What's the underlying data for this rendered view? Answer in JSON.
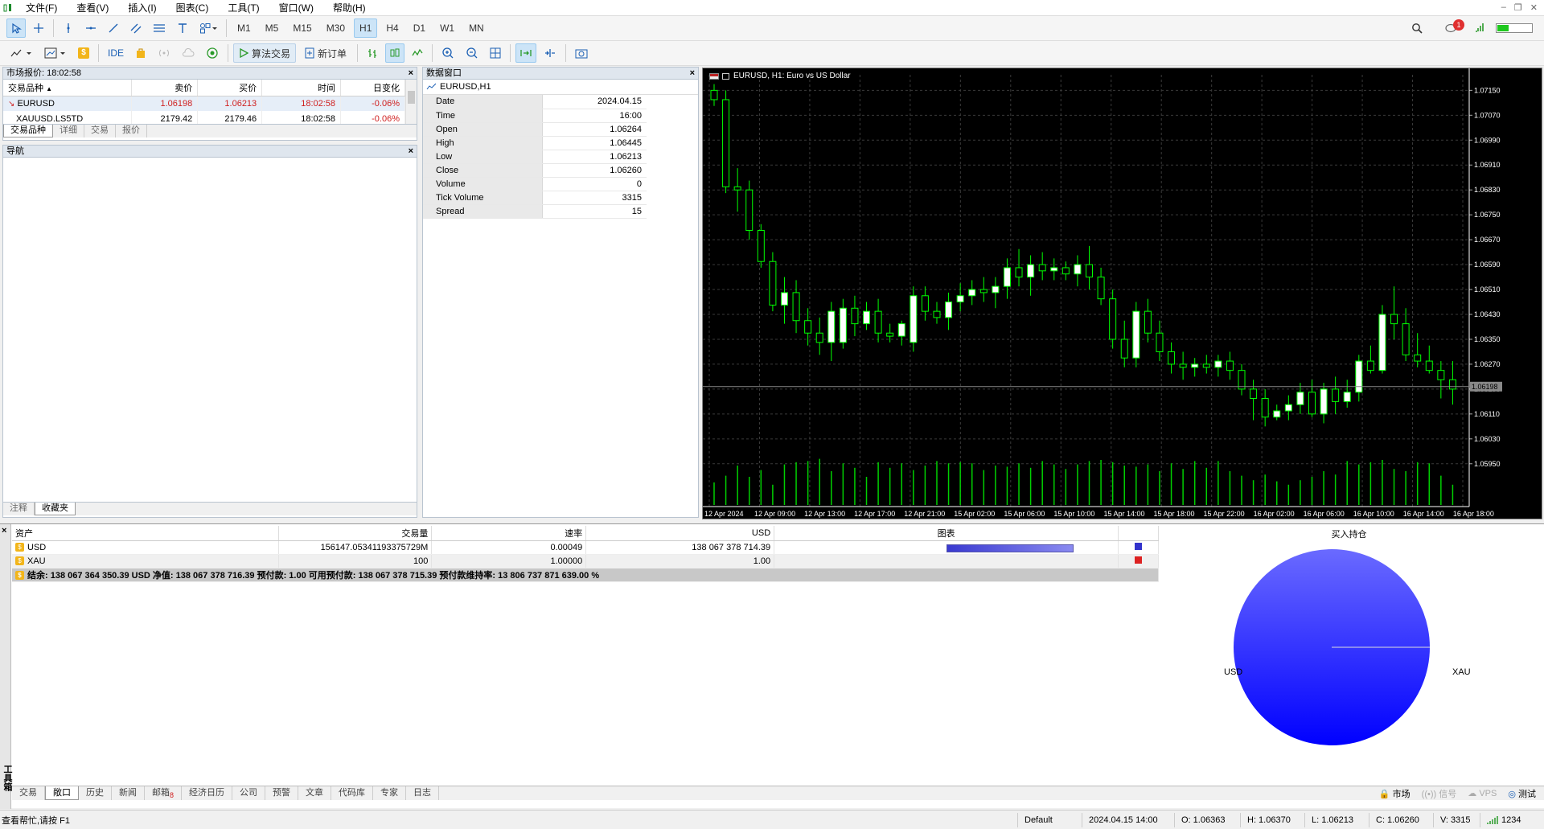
{
  "menu": [
    "文件(F)",
    "查看(V)",
    "插入(I)",
    "图表(C)",
    "工具(T)",
    "窗口(W)",
    "帮助(H)"
  ],
  "timeframes": [
    "M1",
    "M5",
    "M15",
    "M30",
    "H1",
    "H4",
    "D1",
    "W1",
    "MN"
  ],
  "active_timeframe": "H1",
  "toolbar2": {
    "ide": "IDE",
    "algo_trading": "算法交易",
    "new_order": "新订单"
  },
  "notifications_badge": "1",
  "market_watch": {
    "title": "市场报价: 18:02:58",
    "headers": [
      "交易品种",
      "卖价",
      "买价",
      "时间",
      "日变化"
    ],
    "rows": [
      {
        "symbol": "EURUSD",
        "bid": "1.06198",
        "ask": "1.06213",
        "time": "18:02:58",
        "change": "-0.06%"
      },
      {
        "symbol": "XAUUSD.LS5TD",
        "bid": "2179.42",
        "ask": "2179.46",
        "time": "18:02:58",
        "change": "-0.06%"
      }
    ],
    "tabs": [
      "交易品种",
      "详细",
      "交易",
      "报价"
    ],
    "active_tab": "交易品种"
  },
  "navigator": {
    "title": "导航",
    "tabs": [
      "注释",
      "收藏夹"
    ],
    "active_tab": "收藏夹"
  },
  "data_window": {
    "title": "数据窗口",
    "header": "EURUSD,H1",
    "rows": [
      {
        "k": "Date",
        "v": "2024.04.15"
      },
      {
        "k": "Time",
        "v": "16:00"
      },
      {
        "k": "Open",
        "v": "1.06264"
      },
      {
        "k": "High",
        "v": "1.06445"
      },
      {
        "k": "Low",
        "v": "1.06213"
      },
      {
        "k": "Close",
        "v": "1.06260"
      },
      {
        "k": "Volume",
        "v": "0"
      },
      {
        "k": "Tick Volume",
        "v": "3315"
      },
      {
        "k": "Spread",
        "v": "15"
      }
    ]
  },
  "chart": {
    "title": "EURUSD, H1:  Euro vs US Dollar",
    "current_price": "1.06198",
    "colors": {
      "bg": "#000000",
      "bull": "#ffffff",
      "outline": "#00ff00",
      "grid": "#3a3a3a"
    },
    "price_labels": [
      "1.07150",
      "1.07070",
      "1.06990",
      "1.06910",
      "1.06830",
      "1.06750",
      "1.06670",
      "1.06590",
      "1.06510",
      "1.06430",
      "1.06350",
      "1.06270",
      "1.06190",
      "1.06110",
      "1.06030",
      "1.05950"
    ],
    "time_labels": [
      "12 Apr 2024",
      "12 Apr 09:00",
      "12 Apr 13:00",
      "12 Apr 17:00",
      "12 Apr 21:00",
      "15 Apr 02:00",
      "15 Apr 06:00",
      "15 Apr 10:00",
      "15 Apr 14:00",
      "15 Apr 18:00",
      "15 Apr 22:00",
      "16 Apr 02:00",
      "16 Apr 06:00",
      "16 Apr 10:00",
      "16 Apr 14:00",
      "16 Apr 18:00"
    ]
  },
  "chart_data": {
    "type": "candlestick",
    "symbol": "EURUSD",
    "timeframe": "H1",
    "ylim": [
      1.0589,
      1.072
    ],
    "candles": [
      [
        1.0715,
        1.0717,
        1.071,
        1.0712
      ],
      [
        1.0712,
        1.0715,
        1.0682,
        1.0684
      ],
      [
        1.0684,
        1.069,
        1.0676,
        1.0683
      ],
      [
        1.0683,
        1.0686,
        1.0667,
        1.067
      ],
      [
        1.067,
        1.0672,
        1.0658,
        1.066
      ],
      [
        1.066,
        1.0663,
        1.0644,
        1.0646
      ],
      [
        1.0646,
        1.0655,
        1.064,
        1.065
      ],
      [
        1.065,
        1.0654,
        1.0637,
        1.0641
      ],
      [
        1.0641,
        1.0645,
        1.0633,
        1.0637
      ],
      [
        1.0637,
        1.0642,
        1.063,
        1.0634
      ],
      [
        1.0634,
        1.0647,
        1.0628,
        1.0644
      ],
      [
        1.0634,
        1.0648,
        1.0632,
        1.0645
      ],
      [
        1.0645,
        1.0649,
        1.0636,
        1.064
      ],
      [
        1.064,
        1.0647,
        1.0638,
        1.0644
      ],
      [
        1.0644,
        1.0648,
        1.0634,
        1.0637
      ],
      [
        1.0637,
        1.064,
        1.0634,
        1.0636
      ],
      [
        1.0636,
        1.0641,
        1.0633,
        1.064
      ],
      [
        1.0634,
        1.0652,
        1.0631,
        1.0649
      ],
      [
        1.0649,
        1.0652,
        1.0641,
        1.0644
      ],
      [
        1.0644,
        1.0647,
        1.064,
        1.0642
      ],
      [
        1.0642,
        1.065,
        1.0638,
        1.0647
      ],
      [
        1.0647,
        1.0653,
        1.0644,
        1.0649
      ],
      [
        1.0649,
        1.0654,
        1.0646,
        1.0651
      ],
      [
        1.0651,
        1.0655,
        1.0647,
        1.065
      ],
      [
        1.065,
        1.0655,
        1.0645,
        1.0652
      ],
      [
        1.0652,
        1.0661,
        1.0648,
        1.0658
      ],
      [
        1.0658,
        1.0664,
        1.0652,
        1.0655
      ],
      [
        1.0655,
        1.0662,
        1.0649,
        1.0659
      ],
      [
        1.0659,
        1.0663,
        1.0654,
        1.0657
      ],
      [
        1.0657,
        1.0661,
        1.0654,
        1.0658
      ],
      [
        1.0658,
        1.066,
        1.0654,
        1.0656
      ],
      [
        1.0656,
        1.0662,
        1.0652,
        1.0659
      ],
      [
        1.0659,
        1.0665,
        1.0651,
        1.0655
      ],
      [
        1.0655,
        1.0658,
        1.0646,
        1.0648
      ],
      [
        1.0648,
        1.0651,
        1.0632,
        1.0635
      ],
      [
        1.0635,
        1.0641,
        1.0626,
        1.0629
      ],
      [
        1.0629,
        1.0647,
        1.0626,
        1.0644
      ],
      [
        1.0644,
        1.0648,
        1.0634,
        1.0637
      ],
      [
        1.0637,
        1.0641,
        1.0628,
        1.0631
      ],
      [
        1.0631,
        1.0634,
        1.0624,
        1.0627
      ],
      [
        1.0627,
        1.0631,
        1.0622,
        1.0626
      ],
      [
        1.0626,
        1.0629,
        1.0623,
        1.0627
      ],
      [
        1.0627,
        1.063,
        1.0624,
        1.0626
      ],
      [
        1.0626,
        1.063,
        1.0623,
        1.0628
      ],
      [
        1.0628,
        1.0631,
        1.0622,
        1.0625
      ],
      [
        1.0625,
        1.0627,
        1.0617,
        1.0619
      ],
      [
        1.0619,
        1.0622,
        1.0609,
        1.0616
      ],
      [
        1.0616,
        1.0619,
        1.0607,
        1.061
      ],
      [
        1.061,
        1.0614,
        1.0609,
        1.0612
      ],
      [
        1.0612,
        1.0617,
        1.0609,
        1.0614
      ],
      [
        1.0614,
        1.0621,
        1.0611,
        1.0618
      ],
      [
        1.0618,
        1.0622,
        1.061,
        1.0611
      ],
      [
        1.0611,
        1.0621,
        1.0608,
        1.0619
      ],
      [
        1.0619,
        1.0623,
        1.0611,
        1.0615
      ],
      [
        1.0615,
        1.0622,
        1.0613,
        1.0618
      ],
      [
        1.0618,
        1.063,
        1.0615,
        1.0628
      ],
      [
        1.0628,
        1.0633,
        1.0624,
        1.0625
      ],
      [
        1.0625,
        1.0646,
        1.0624,
        1.0643
      ],
      [
        1.0643,
        1.0652,
        1.0635,
        1.064
      ],
      [
        1.064,
        1.0645,
        1.0628,
        1.063
      ],
      [
        1.063,
        1.0637,
        1.0626,
        1.0628
      ],
      [
        1.0628,
        1.0633,
        1.0624,
        1.0625
      ],
      [
        1.0625,
        1.0628,
        1.0616,
        1.0622
      ],
      [
        1.0622,
        1.0628,
        1.0614,
        1.0619
      ]
    ],
    "volumes": [
      20,
      26,
      35,
      25,
      31,
      18,
      36,
      38,
      39,
      41,
      30,
      37,
      33,
      25,
      38,
      33,
      37,
      31,
      35,
      39,
      37,
      38,
      37,
      31,
      35,
      34,
      37,
      33,
      39,
      36,
      32,
      36,
      39,
      40,
      38,
      35,
      34,
      36,
      30,
      37,
      32,
      39,
      33,
      39,
      30,
      26,
      22,
      27,
      21,
      18,
      22,
      25,
      30,
      27,
      39,
      36,
      38,
      40,
      32,
      30,
      38,
      37,
      26,
      18
    ],
    "current_price": 1.06198
  },
  "toolbox": {
    "headers": [
      "资产",
      "交易量",
      "速率",
      "USD",
      "图表"
    ],
    "rows": [
      {
        "asset": "USD",
        "volume": "156147.05341193375729M",
        "rate": "0.00049",
        "usd": "138 067 378 714.39",
        "color": "#3333cc",
        "bar_fraction": 1.0
      },
      {
        "asset": "XAU",
        "volume": "100",
        "rate": "1.00000",
        "usd": "1.00",
        "color": "#dd2222",
        "bar_fraction": 0.0
      }
    ],
    "summary": "结余: 138 067 364 350.39 USD  净值: 138 067 378 716.39  预付款: 1.00  可用预付款: 138 067 378 715.39  预付款维持率: 13 806 737 871 639.00 %",
    "pie": {
      "title": "买入持仓",
      "labels": [
        "USD",
        "XAU"
      ]
    },
    "side_label": "工具箱",
    "tabs": [
      "交易",
      "敞口",
      "历史",
      "新闻",
      "邮箱",
      "经济日历",
      "公司",
      "预警",
      "文章",
      "代码库",
      "专家",
      "日志"
    ],
    "mail_badge": "8",
    "active_tab": "敞口",
    "right_items": [
      "市场",
      "信号",
      "VPS",
      "测试"
    ]
  },
  "status": {
    "help": "查看帮忙,请按 F1",
    "profile": "Default",
    "datetime": "2024.04.15 14:00",
    "open": "O: 1.06363",
    "high": "H: 1.06370",
    "low": "L: 1.06213",
    "close": "C: 1.06260",
    "volume": "V: 3315",
    "ping": "1234"
  }
}
